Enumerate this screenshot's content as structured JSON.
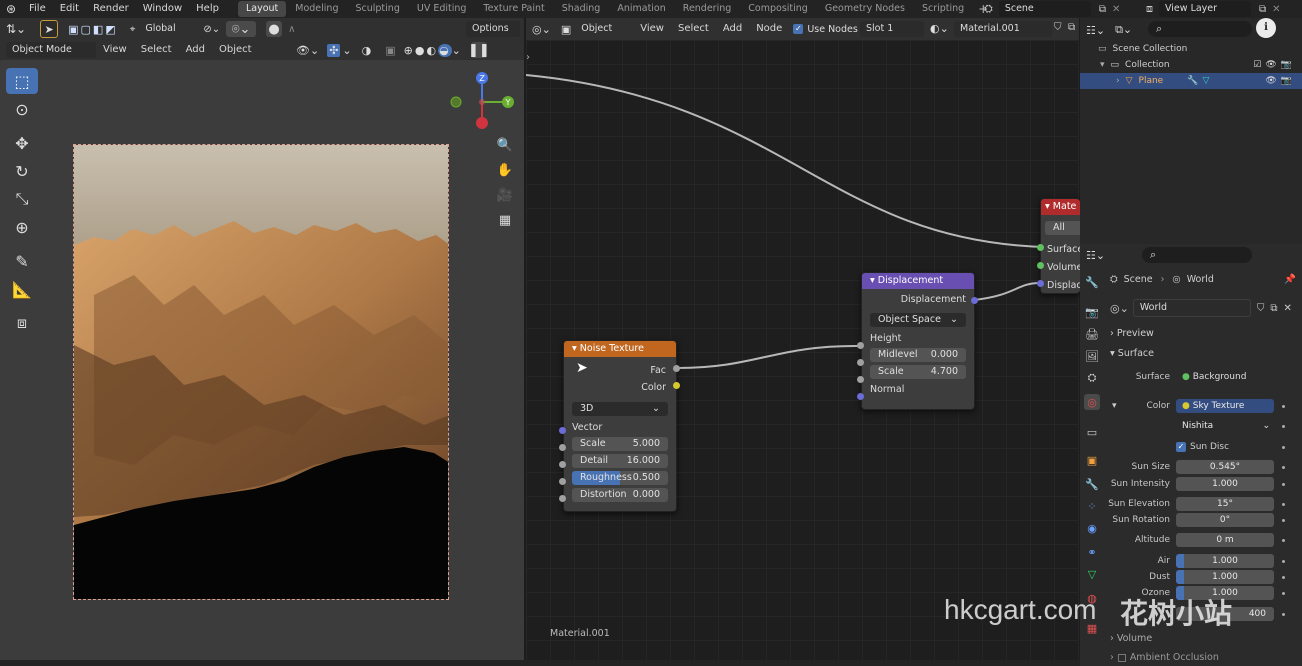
{
  "menus": [
    "File",
    "Edit",
    "Render",
    "Window",
    "Help"
  ],
  "workspaces": [
    "Layout",
    "Modeling",
    "Sculpting",
    "UV Editing",
    "Texture Paint",
    "Shading",
    "Animation",
    "Rendering",
    "Compositing",
    "Geometry Nodes",
    "Scripting"
  ],
  "active_workspace": "Layout",
  "scene_name": "Scene",
  "view_layer": "View Layer",
  "viewport": {
    "mode": "Object Mode",
    "menus": [
      "View",
      "Select",
      "Add",
      "Object"
    ],
    "transform_orientation": "Global",
    "options_label": "Options",
    "gizmo_axes": {
      "x": "",
      "y": "Y",
      "z": "Z"
    }
  },
  "node_editor": {
    "object_type": "Object",
    "menus": [
      "View",
      "Select",
      "Add",
      "Node"
    ],
    "use_nodes_label": "Use Nodes",
    "slot": "Slot 1",
    "material": "Material.001",
    "footer_material": "Material.001",
    "output_node": {
      "title": "Mate",
      "target": "All",
      "inputs": [
        "Surface",
        "Volume",
        "Displace"
      ]
    },
    "displacement_node": {
      "title": "Displacement",
      "output": "Displacement",
      "space": "Object Space",
      "inputs": [
        "Height",
        "Normal"
      ],
      "midlevel_label": "Midlevel",
      "midlevel": "0.000",
      "scale_label": "Scale",
      "scale": "4.700"
    },
    "noise_node": {
      "title": "Noise Texture",
      "outputs": [
        "Fac",
        "Color"
      ],
      "dimensions": "3D",
      "vector_label": "Vector",
      "fields": [
        {
          "label": "Scale",
          "value": "5.000"
        },
        {
          "label": "Detail",
          "value": "16.000"
        },
        {
          "label": "Roughness",
          "value": "0.500"
        },
        {
          "label": "Distortion",
          "value": "0.000"
        }
      ]
    }
  },
  "outliner": {
    "root": "Scene Collection",
    "collection": "Collection",
    "object": "Plane"
  },
  "properties": {
    "breadcrumb_scene": "Scene",
    "breadcrumb_world": "World",
    "world_name": "World",
    "preview": "Preview",
    "surface_panel": "Surface",
    "surface_label": "Surface",
    "surface_value": "Background",
    "color_label": "Color",
    "color_value": "Sky Texture",
    "sky_type": "Nishita",
    "sun_disc": "Sun Disc",
    "rows": [
      {
        "label": "Sun Size",
        "value": "0.545°"
      },
      {
        "label": "Sun Intensity",
        "value": "1.000"
      },
      {
        "label": "Sun Elevation",
        "value": "15°"
      },
      {
        "label": "Sun Rotation",
        "value": "0°"
      },
      {
        "label": "Altitude",
        "value": "0 m"
      },
      {
        "label": "Air",
        "value": "1.000"
      },
      {
        "label": "Dust",
        "value": "1.000"
      },
      {
        "label": "Ozone",
        "value": "1.000"
      },
      {
        "label": "",
        "value": "400"
      }
    ],
    "volume": "Volume",
    "ambient_occlusion": "Ambient Occlusion"
  },
  "watermark": {
    "text": "hkcgart.com",
    "text2": "花树小站"
  },
  "colors": {
    "accent": "#4772b3",
    "noise_header": "#c0661e",
    "displacement_header": "#6a4fb3",
    "output_header": "#b02c2c"
  }
}
